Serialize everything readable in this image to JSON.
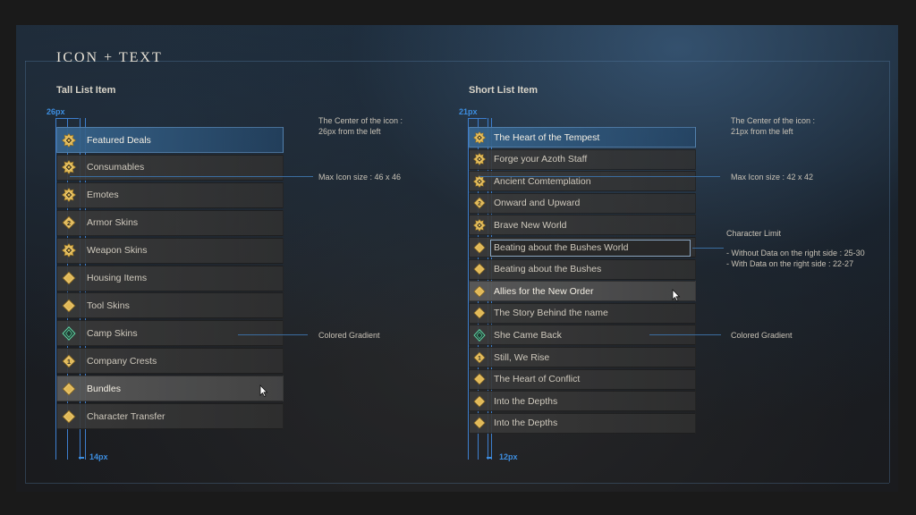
{
  "title": "ICON + TEXT",
  "tall": {
    "title": "Tall List Item",
    "offset_label": "26px",
    "gap_label": "14px",
    "notes": {
      "center": [
        "The Center of the icon :",
        "26px from the left"
      ],
      "max_icon": "Max Icon size :  46 x 46",
      "gradient": "Colored Gradient"
    },
    "items": [
      {
        "label": "Featured Deals",
        "icon": "emblem-icon",
        "state": "selected"
      },
      {
        "label": "Consumables",
        "icon": "emblem-icon",
        "state": "normal"
      },
      {
        "label": "Emotes",
        "icon": "emblem-icon",
        "state": "normal"
      },
      {
        "label": "Armor Skins",
        "icon": "diamond-2-icon",
        "state": "normal"
      },
      {
        "label": "Weapon Skins",
        "icon": "emblem-icon",
        "state": "normal"
      },
      {
        "label": "Housing Items",
        "icon": "diamond-icon",
        "state": "normal"
      },
      {
        "label": "Tool Skins",
        "icon": "diamond-icon",
        "state": "normal"
      },
      {
        "label": "Camp Skins",
        "icon": "green-diamond-icon",
        "state": "normal"
      },
      {
        "label": "Company Crests",
        "icon": "diamond-1-icon",
        "state": "normal"
      },
      {
        "label": "Bundles",
        "icon": "diamond-icon",
        "state": "hover"
      },
      {
        "label": "Character Transfer",
        "icon": "diamond-icon",
        "state": "normal"
      }
    ]
  },
  "short": {
    "title": "Short List Item",
    "offset_label": "21px",
    "gap_label": "12px",
    "notes": {
      "center": [
        "The Center of the icon :",
        "21px from the left"
      ],
      "max_icon": "Max Icon size :  42 x 42",
      "char_limit_title": "Character Limit",
      "char_limit_lines": [
        "- Without Data on the right side : 25-30",
        "- With Data on the right side : 22-27"
      ],
      "gradient": "Colored Gradient"
    },
    "items": [
      {
        "label": "The Heart of the Tempest",
        "icon": "emblem-icon",
        "state": "selected"
      },
      {
        "label": "Forge your Azoth Staff",
        "icon": "emblem-icon",
        "state": "normal"
      },
      {
        "label": "Ancient Comtemplation",
        "icon": "emblem-icon",
        "state": "normal"
      },
      {
        "label": "Onward and Upward",
        "icon": "diamond-2-icon",
        "state": "normal"
      },
      {
        "label": "Brave New World",
        "icon": "emblem-icon",
        "state": "normal"
      },
      {
        "label": "Beating about the Bushes World",
        "icon": "diamond-icon",
        "state": "outlined"
      },
      {
        "label": "Beating about the Bushes",
        "icon": "diamond-icon",
        "state": "normal"
      },
      {
        "label": "Allies for the New Order",
        "icon": "diamond-icon",
        "state": "hover"
      },
      {
        "label": "The Story Behind the name",
        "icon": "diamond-icon",
        "state": "normal"
      },
      {
        "label": "She Came Back",
        "icon": "green-diamond-icon",
        "state": "normal"
      },
      {
        "label": "Still, We Rise",
        "icon": "diamond-1-icon",
        "state": "normal"
      },
      {
        "label": "The Heart of Conflict",
        "icon": "diamond-icon",
        "state": "normal"
      },
      {
        "label": "Into the Depths",
        "icon": "diamond-icon",
        "state": "normal"
      },
      {
        "label": "Into the Depths",
        "icon": "diamond-icon",
        "state": "normal"
      }
    ]
  },
  "colors": {
    "gold": "#e2b955",
    "selected": "#2f5f8a",
    "guide_blue": "#3d8ee0",
    "green": "#5fd0a0"
  }
}
